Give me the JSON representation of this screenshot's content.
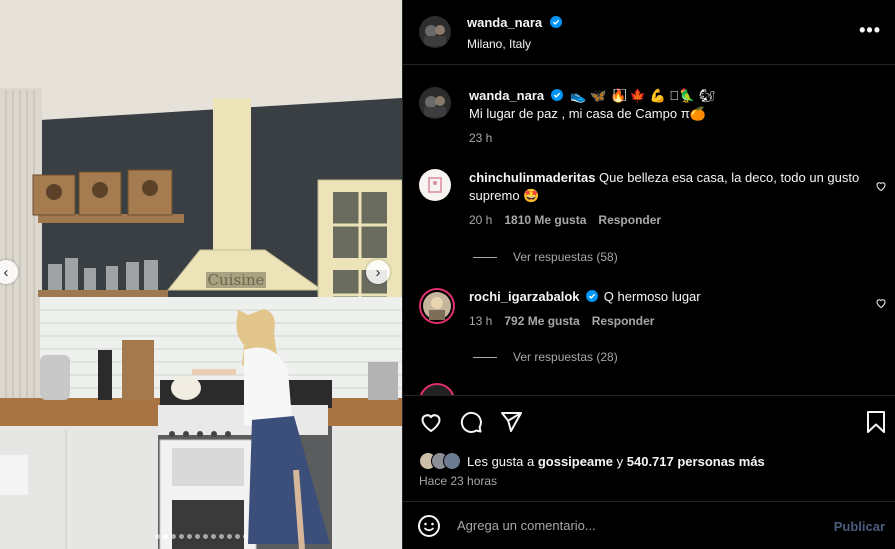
{
  "photo": {
    "carousel_dots": 12,
    "active_dot": 1,
    "prev_arrow": "‹",
    "next_arrow": "›",
    "sign_text": "Cuisine"
  },
  "post": {
    "username": "wanda_nara",
    "location": "Milano, Italy",
    "more_label": "•••"
  },
  "caption": {
    "username": "wanda_nara",
    "emojis": "👟 🦋 🔥⃞⃞⃞ 🍁 💪 ⃞🦜 🐿",
    "text": "Mi lugar de paz , mi casa de Campo π🍊",
    "time": "23 h"
  },
  "comments": [
    {
      "username": "chinchulinmaderitas",
      "text": "Que belleza esa casa, la deco, todo un gusto supremo 🤩",
      "time": "20 h",
      "likes": "1810 Me gusta",
      "reply": "Responder",
      "view_replies": "Ver respuestas (58)"
    },
    {
      "username": "rochi_igarzabalok",
      "verified": true,
      "text": "Q hermoso lugar",
      "time": "13 h",
      "likes": "792 Me gusta",
      "reply": "Responder",
      "view_replies": "Ver respuestas (28)"
    }
  ],
  "likes": {
    "prefix": "Les gusta a",
    "user": "gossipeame",
    "connector": "y",
    "count": "540.717 personas más"
  },
  "time_ago": "Hace 23 horas",
  "comment_box": {
    "placeholder": "Agrega un comentario...",
    "publish": "Publicar"
  },
  "colors": {
    "background": "#000000",
    "divider": "#262626",
    "secondary_text": "#a8a8a8",
    "verified_blue": "#0095f6",
    "publish_disabled": "#4a5d7e"
  },
  "icons": [
    "heart-icon",
    "comment-icon",
    "share-icon",
    "bookmark-icon",
    "emoji-icon",
    "verified-icon",
    "more-icon"
  ]
}
